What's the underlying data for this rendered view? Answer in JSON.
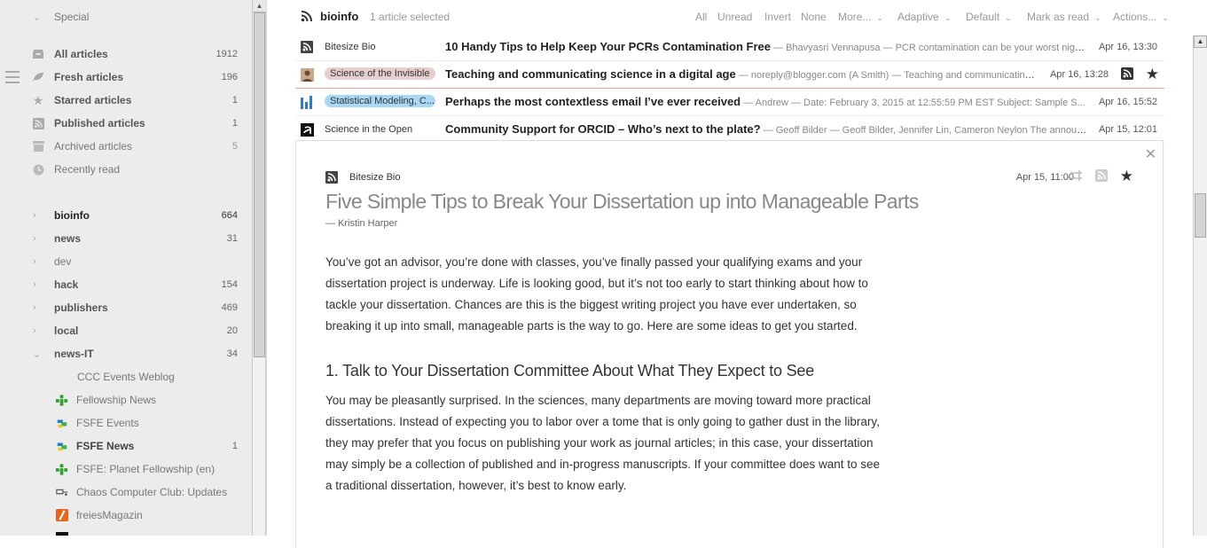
{
  "sidebar": {
    "special_header": "Special",
    "special_items": [
      {
        "label": "All articles",
        "count": "1912",
        "icon": "archive-icon"
      },
      {
        "label": "Fresh articles",
        "count": "196",
        "icon": "leaf-icon"
      },
      {
        "label": "Starred articles",
        "count": "1",
        "icon": "star-icon"
      },
      {
        "label": "Published articles",
        "count": "1",
        "icon": "rss-icon"
      },
      {
        "label": "Archived articles",
        "count": "5",
        "icon": "archive-box-icon"
      },
      {
        "label": "Recently read",
        "count": "",
        "icon": "clock-icon"
      }
    ],
    "categories": [
      {
        "label": "bioinfo",
        "count": "664"
      },
      {
        "label": "news",
        "count": "31"
      },
      {
        "label": "dev",
        "count": ""
      },
      {
        "label": "hack",
        "count": "154"
      },
      {
        "label": "publishers",
        "count": "469"
      },
      {
        "label": "local",
        "count": "20"
      },
      {
        "label": "news-IT",
        "count": "34"
      }
    ],
    "feeds": [
      {
        "label": "CCC Events Weblog",
        "count": ""
      },
      {
        "label": "Fellowship News",
        "count": ""
      },
      {
        "label": "FSFE Events",
        "count": ""
      },
      {
        "label": "FSFE News",
        "count": "1"
      },
      {
        "label": "FSFE: Planet Fellowship (en)",
        "count": ""
      },
      {
        "label": "Chaos Computer Club: Updates",
        "count": ""
      },
      {
        "label": "freiesMagazin",
        "count": ""
      }
    ]
  },
  "toolbar": {
    "feed_title": "bioinfo",
    "selection": "1 article selected",
    "all": "All",
    "unread": "Unread",
    "invert": "Invert",
    "none": "None",
    "more": "More...",
    "adaptive": "Adaptive",
    "default": "Default",
    "mark_as_read": "Mark as read",
    "actions": "Actions..."
  },
  "headlines": [
    {
      "feed": "Bitesize Bio",
      "title": "10 Handy Tips to Help Keep Your PCRs Contamination Free",
      "excerpt": " — Bhavyasri Vennapusa — PCR contamination can be your worst nightmare",
      "date": "Apr 16, 13:30"
    },
    {
      "feed": "Science of the Invisible",
      "title": "Teaching and communicating science in a digital age",
      "excerpt": " — noreply@blogger.com (A Smith) — Teaching and communicating science",
      "date": "Apr 16, 13:28"
    },
    {
      "feed": "Statistical Modeling, C...",
      "title": "Perhaps the most contextless email I’ve ever received",
      "excerpt": " — Andrew — Date: February 3, 2015 at 12:55:59 PM EST Subject: Sample S...",
      "date": "Apr 16, 15:52"
    },
    {
      "feed": "Science in the Open",
      "title": "Community Support for ORCID – Who’s next to the plate?",
      "excerpt": " — Geoff Bilder — Geoff Bilder, Jennifer Lin, Cameron Neylon The announ...",
      "date": "Apr 15, 12:01"
    }
  ],
  "article": {
    "source": "Bitesize Bio",
    "date": "Apr 15, 11:00",
    "title": "Five Simple Tips to Break Your Dissertation up into Manageable Parts",
    "author": "— Kristin Harper",
    "p1": "You’ve got an advisor, you’re done with classes, you’ve finally passed your qualifying exams and your dissertation project is underway. Life is looking good, but it’s not too early to start thinking about how to tackle your dissertation. Chances are this is the biggest writing project you have ever undertaken, so breaking it up into small, manageable parts is the way to go. Here are some ideas to get you started.",
    "h2": "1. Talk to Your Dissertation Committee About What They Expect to See",
    "p2": "You may be pleasantly surprised. In the sciences, many departments are moving toward more practical dissertations. Instead of expecting you to labor over a tome that is only going to gather dust in the library, they may prefer that you focus on publishing your work as journal articles; in this case, your dissertation may simply be a collection of published and in-progress manuscripts. If your committee does want to see a traditional dissertation, however, it’s best to know early."
  },
  "colors": {
    "sidebar_bg": "#ececec",
    "pill_science_invisible": "#e6cfcf",
    "pill_statistical": "#a9d8f5",
    "selected_border": "#e8a0a0"
  }
}
